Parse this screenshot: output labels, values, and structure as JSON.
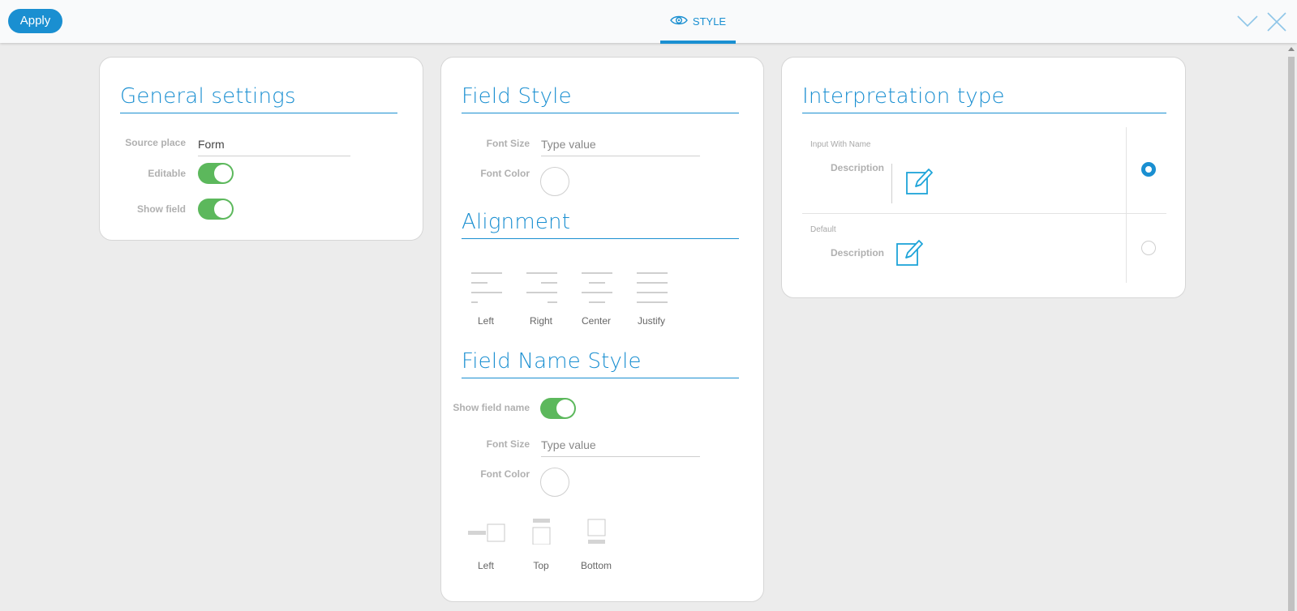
{
  "toolbar": {
    "apply_label": "Apply",
    "tab_label": "STYLE",
    "accent": "#1a8fd1",
    "icons": [
      "eye-icon",
      "chevron-down-icon",
      "close-icon"
    ]
  },
  "general": {
    "title": "General settings",
    "source_place_label": "Source place",
    "source_place_value": "Form",
    "editable_label": "Editable",
    "editable_on": true,
    "show_field_label": "Show field",
    "show_field_on": true,
    "toggle_color": "#5cb85c"
  },
  "field_style": {
    "title": "Field Style",
    "font_size_label": "Font Size",
    "font_size_placeholder": "Type value",
    "font_color_label": "Font Color"
  },
  "alignment": {
    "title": "Alignment",
    "options": [
      {
        "label": "Left",
        "icon": "align-left-icon"
      },
      {
        "label": "Right",
        "icon": "align-right-icon"
      },
      {
        "label": "Center",
        "icon": "align-center-icon"
      },
      {
        "label": "Justify",
        "icon": "align-justify-icon"
      }
    ]
  },
  "field_name_style": {
    "title": "Field Name Style",
    "show_field_name_label": "Show field name",
    "show_field_name_on": true,
    "font_size_label": "Font Size",
    "font_size_placeholder": "Type value",
    "font_color_label": "Font Color",
    "positions": [
      {
        "label": "Left",
        "icon": "label-left-icon"
      },
      {
        "label": "Top",
        "icon": "label-top-icon"
      },
      {
        "label": "Bottom",
        "icon": "label-bottom-icon"
      }
    ]
  },
  "interpretation": {
    "title": "Interpretation type",
    "options": [
      {
        "name": "Input With Name",
        "description": "Description",
        "selected": true,
        "icon": "edit-icon"
      },
      {
        "name": "Default",
        "description": "Description",
        "selected": false,
        "icon": "edit-icon"
      }
    ]
  }
}
